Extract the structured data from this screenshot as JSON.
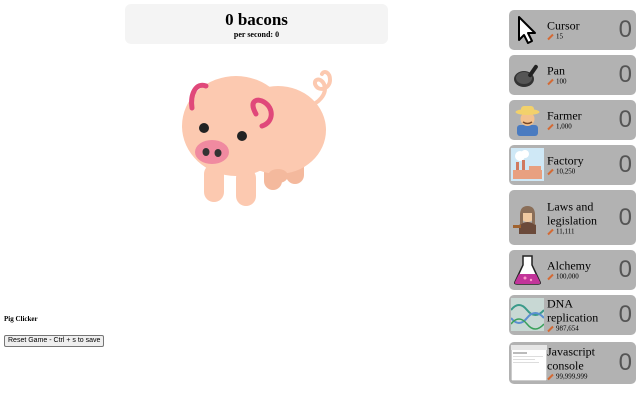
{
  "score": {
    "count_text": "0 bacons",
    "rate_text": "per second: 0"
  },
  "game": {
    "title": "Pig Clicker",
    "reset_label": "Reset Game - Ctrl + s to save"
  },
  "colors": {
    "store_item_bg": "#b2b2b2",
    "pig_body": "#fcc9b0",
    "pig_accent": "#e0487a",
    "bacon": "#d46a34"
  },
  "store": {
    "items": [
      {
        "name": "Cursor",
        "price": "15",
        "count": "0",
        "icon": "cursor-icon"
      },
      {
        "name": "Pan",
        "price": "100",
        "count": "0",
        "icon": "pan-icon"
      },
      {
        "name": "Farmer",
        "price": "1,000",
        "count": "0",
        "icon": "farmer-icon"
      },
      {
        "name": "Factory",
        "price": "10,250",
        "count": "0",
        "icon": "factory-icon"
      },
      {
        "name": "Laws and legislation",
        "price": "11,111",
        "count": "0",
        "icon": "judge-icon"
      },
      {
        "name": "Alchemy",
        "price": "100,000",
        "count": "0",
        "icon": "flask-icon"
      },
      {
        "name": "DNA replication",
        "price": "987,654",
        "count": "0",
        "icon": "dna-icon"
      },
      {
        "name": "Javascript console",
        "price": "99,999,999",
        "count": "0",
        "icon": "console-icon"
      }
    ]
  }
}
